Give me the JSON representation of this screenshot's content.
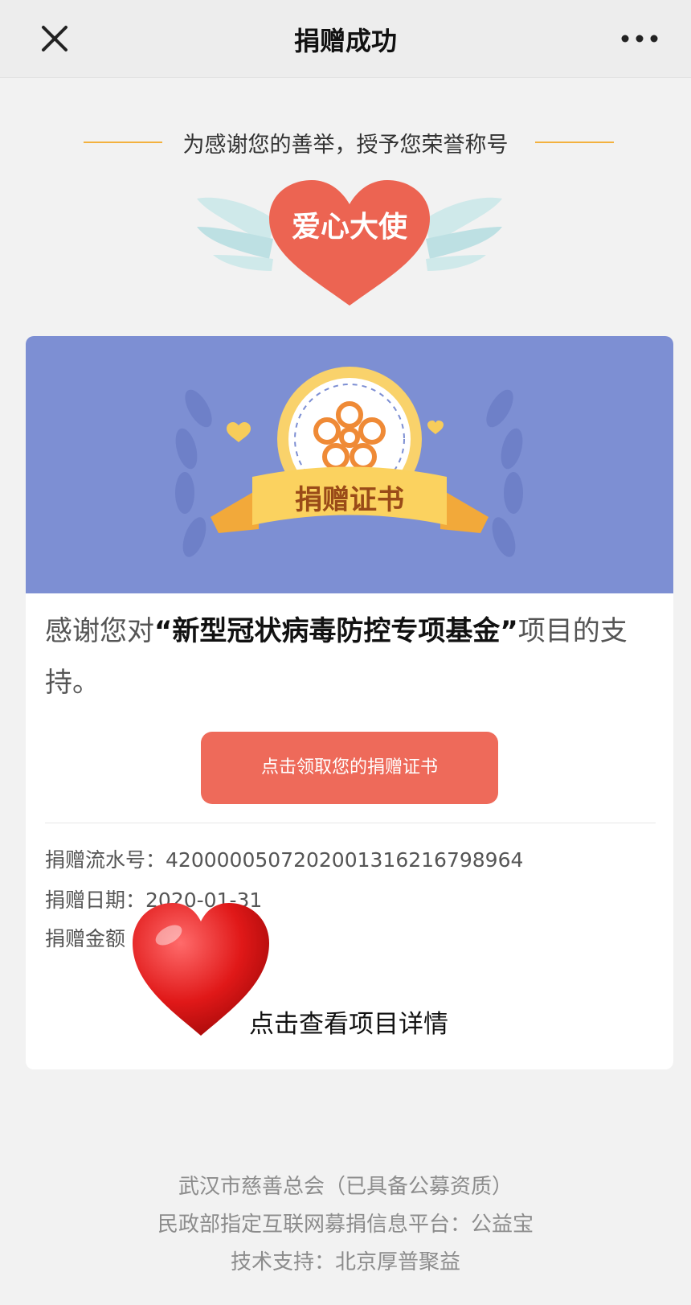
{
  "nav": {
    "title": "捐赠成功",
    "close_icon": "close-icon",
    "more_icon": "more-icon"
  },
  "honor": {
    "subtitle": "为感谢您的善举，授予您荣誉称号",
    "badge_text": "爱心大使"
  },
  "certificate": {
    "ribbon_text": "捐赠证书"
  },
  "thanks": {
    "prefix": "感谢您对",
    "project": "“新型冠状病毒防控专项基金”",
    "suffix": "项目的支持。"
  },
  "claim_button": "点击领取您的捐赠证书",
  "info": {
    "serial_label": "捐赠流水号：",
    "serial_value": "4200000507202001316216798964",
    "date_label": "捐赠日期：",
    "date_value": "2020-01-31",
    "amount_label": "捐赠金额"
  },
  "detail_link": "点击查看项目详情",
  "footer": {
    "line1": "武汉市慈善总会（已具备公募资质）",
    "line2": "民政部指定互联网募捐信息平台：公益宝",
    "line3": "技术支持：北京厚普聚益"
  },
  "colors": {
    "accent": "#ee6a5a",
    "banner": "#7d8fd3",
    "gold": "#f3b13e"
  }
}
